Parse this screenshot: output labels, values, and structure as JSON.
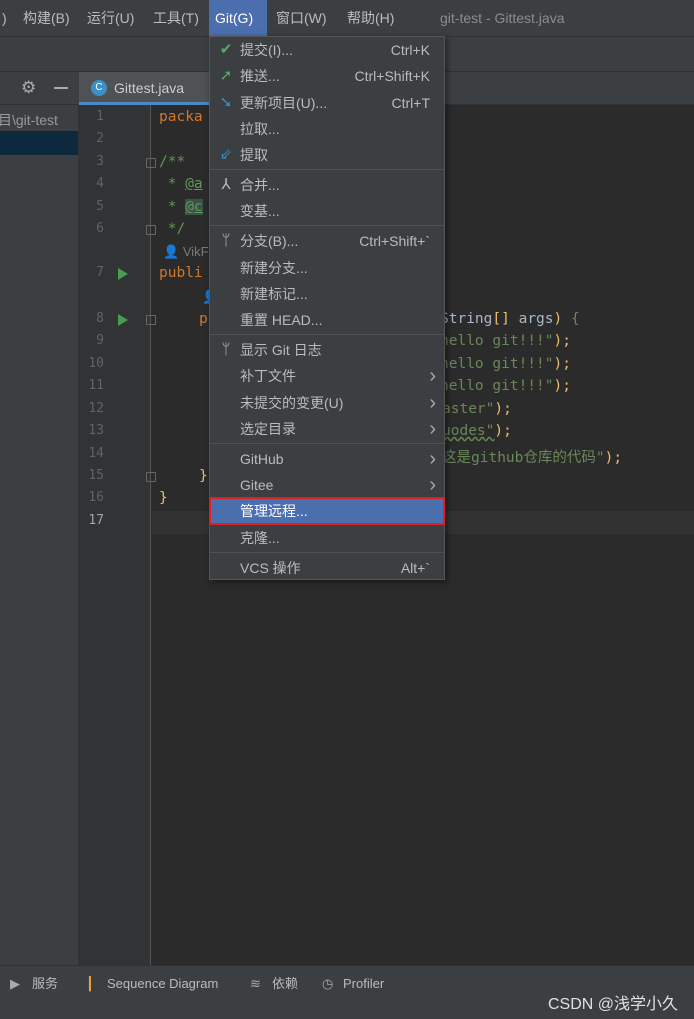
{
  "menubar": {
    "items": [
      {
        "label": ")"
      },
      {
        "label": "构建(B)"
      },
      {
        "label": "运行(U)"
      },
      {
        "label": "工具(T)"
      },
      {
        "label": "Git(G)"
      },
      {
        "label": "窗口(W)"
      },
      {
        "label": "帮助(H)"
      }
    ],
    "title": "git-test - Gittest.java"
  },
  "tab": {
    "label": "Gittest.java",
    "project_path": "目\\git-test"
  },
  "editor": {
    "line_numbers": [
      "1",
      "2",
      "3",
      "4",
      "5",
      "6",
      "7",
      "8",
      "9",
      "10",
      "11",
      "12",
      "13",
      "14",
      "15",
      "16",
      "17"
    ],
    "left": {
      "l1": "packa",
      "l3": "/**",
      "l4a": " * ",
      "l4b": "@a",
      "l5a": " * ",
      "l5b": "@c",
      "l6": " */",
      "hint1": "VikF",
      "l7": "publi",
      "l8": "p",
      "l15": "}",
      "l16": "}"
    },
    "right": {
      "l8a": "String",
      "l8b": "[]",
      "l8c": " args",
      ")": ")",
      "l8e": " {",
      "l9": "hello git!!!\"",
      "l10": "hello git!!!\"",
      "l11": "hello git!!!\"",
      "l12": "aster\"",
      "l13": "uodes\"",
      "l14": "这是github仓库的代码\"",
      "close": ");"
    }
  },
  "git_menu": {
    "items": [
      {
        "icon": "check-icon",
        "label": "提交(I)...",
        "shortcut": "Ctrl+K"
      },
      {
        "icon": "push-arrow-icon",
        "label": "推送...",
        "shortcut": "Ctrl+Shift+K"
      },
      {
        "icon": "update-arrow-icon",
        "label": "更新项目(U)...",
        "shortcut": "Ctrl+T"
      },
      {
        "label": "拉取..."
      },
      {
        "icon": "fetch-icon",
        "label": "提取"
      },
      {
        "icon": "merge-icon",
        "label": "合并..."
      },
      {
        "label": "变基..."
      },
      {
        "icon": "branch-icon",
        "label": "分支(B)...",
        "shortcut": "Ctrl+Shift+`"
      },
      {
        "label": "新建分支..."
      },
      {
        "label": "新建标记..."
      },
      {
        "label": "重置 HEAD..."
      },
      {
        "icon": "branch-icon",
        "label": "显示 Git 日志"
      },
      {
        "label": "补丁文件",
        "submenu": true
      },
      {
        "label": "未提交的变更(U)",
        "submenu": true
      },
      {
        "label": "选定目录",
        "submenu": true
      },
      {
        "label": "GitHub",
        "submenu": true
      },
      {
        "label": "Gitee",
        "submenu": true
      },
      {
        "label": "管理远程...",
        "selected": true
      },
      {
        "label": "克隆..."
      },
      {
        "label": "VCS 操作",
        "shortcut": "Alt+`"
      }
    ]
  },
  "bottom": {
    "items": [
      "服务",
      "Sequence Diagram",
      "依赖",
      "Profiler"
    ]
  },
  "watermark": "CSDN @浅学小久",
  "colors": {
    "accent": "#4b6eaf",
    "highlight_border": "#e02020"
  }
}
